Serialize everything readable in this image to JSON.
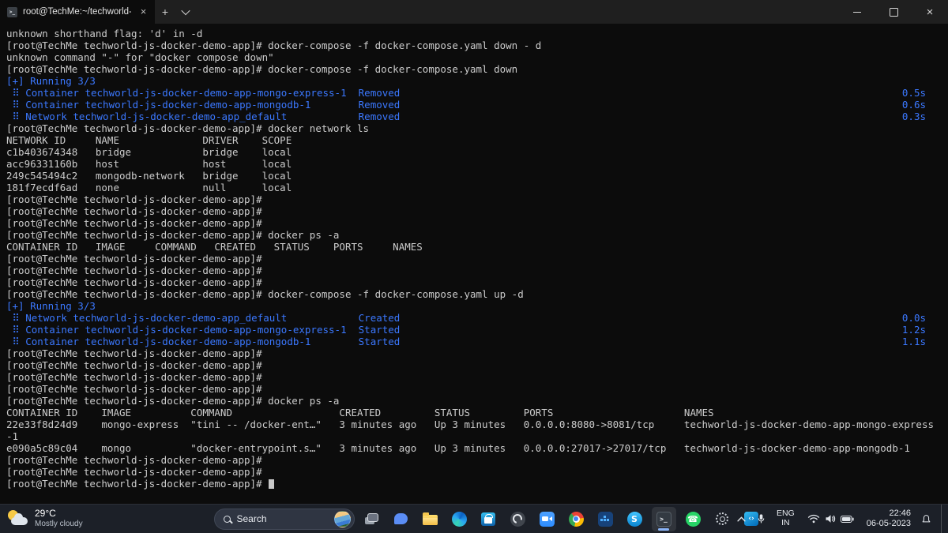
{
  "window": {
    "tab_title": "root@TechMe:~/techworld-js"
  },
  "terminal": {
    "lines": [
      {
        "c": "fg",
        "t": "unknown shorthand flag: 'd' in -d"
      },
      {
        "c": "fg",
        "t": "[root@TechMe techworld-js-docker-demo-app]# docker-compose -f docker-compose.yaml down - d"
      },
      {
        "c": "fg",
        "t": "unknown command \"-\" for \"docker compose down\""
      },
      {
        "c": "fg",
        "t": "[root@TechMe techworld-js-docker-demo-app]# docker-compose -f docker-compose.yaml down"
      },
      {
        "c": "blue",
        "t": "[+] Running 3/3"
      },
      {
        "c": "blue",
        "t": " ⠿ Container techworld-js-docker-demo-app-mongo-express-1  Removed",
        "r": "0.5s"
      },
      {
        "c": "blue",
        "t": " ⠿ Container techworld-js-docker-demo-app-mongodb-1        Removed",
        "r": "0.6s"
      },
      {
        "c": "blue",
        "t": " ⠿ Network techworld-js-docker-demo-app_default            Removed",
        "r": "0.3s"
      },
      {
        "c": "fg",
        "t": "[root@TechMe techworld-js-docker-demo-app]# docker network ls"
      },
      {
        "c": "fg",
        "t": "NETWORK ID     NAME              DRIVER    SCOPE"
      },
      {
        "c": "fg",
        "t": "c1b403674348   bridge            bridge    local"
      },
      {
        "c": "fg",
        "t": "acc96331160b   host              host      local"
      },
      {
        "c": "fg",
        "t": "249c545494c2   mongodb-network   bridge    local"
      },
      {
        "c": "fg",
        "t": "181f7ecdf6ad   none              null      local"
      },
      {
        "c": "fg",
        "t": "[root@TechMe techworld-js-docker-demo-app]#"
      },
      {
        "c": "fg",
        "t": "[root@TechMe techworld-js-docker-demo-app]#"
      },
      {
        "c": "fg",
        "t": "[root@TechMe techworld-js-docker-demo-app]#"
      },
      {
        "c": "fg",
        "t": "[root@TechMe techworld-js-docker-demo-app]# docker ps -a"
      },
      {
        "c": "fg",
        "t": "CONTAINER ID   IMAGE     COMMAND   CREATED   STATUS    PORTS     NAMES"
      },
      {
        "c": "fg",
        "t": "[root@TechMe techworld-js-docker-demo-app]#"
      },
      {
        "c": "fg",
        "t": "[root@TechMe techworld-js-docker-demo-app]#"
      },
      {
        "c": "fg",
        "t": "[root@TechMe techworld-js-docker-demo-app]#"
      },
      {
        "c": "fg",
        "t": "[root@TechMe techworld-js-docker-demo-app]# docker-compose -f docker-compose.yaml up -d"
      },
      {
        "c": "blue",
        "t": "[+] Running 3/3"
      },
      {
        "c": "blue",
        "t": " ⠿ Network techworld-js-docker-demo-app_default            Created",
        "r": "0.0s"
      },
      {
        "c": "blue",
        "t": " ⠿ Container techworld-js-docker-demo-app-mongo-express-1  Started",
        "r": "1.2s"
      },
      {
        "c": "blue",
        "t": " ⠿ Container techworld-js-docker-demo-app-mongodb-1        Started",
        "r": "1.1s"
      },
      {
        "c": "fg",
        "t": "[root@TechMe techworld-js-docker-demo-app]#"
      },
      {
        "c": "fg",
        "t": "[root@TechMe techworld-js-docker-demo-app]#"
      },
      {
        "c": "fg",
        "t": "[root@TechMe techworld-js-docker-demo-app]#"
      },
      {
        "c": "fg",
        "t": "[root@TechMe techworld-js-docker-demo-app]#"
      },
      {
        "c": "fg",
        "t": "[root@TechMe techworld-js-docker-demo-app]# docker ps -a"
      },
      {
        "c": "fg",
        "t": "CONTAINER ID    IMAGE          COMMAND                  CREATED         STATUS         PORTS                      NAMES"
      },
      {
        "c": "fg",
        "t": "22e33f8d24d9    mongo-express  \"tini -- /docker-ent…\"   3 minutes ago   Up 3 minutes   0.0.0.0:8080->8081/tcp     techworld-js-docker-demo-app-mongo-express"
      },
      {
        "c": "fg",
        "t": "-1"
      },
      {
        "c": "fg",
        "t": "e090a5c89c04    mongo          \"docker-entrypoint.s…\"   3 minutes ago   Up 3 minutes   0.0.0.0:27017->27017/tcp   techworld-js-docker-demo-app-mongodb-1"
      },
      {
        "c": "fg",
        "t": "[root@TechMe techworld-js-docker-demo-app]#"
      },
      {
        "c": "fg",
        "t": "[root@TechMe techworld-js-docker-demo-app]#"
      },
      {
        "c": "fg",
        "t": "[root@TechMe techworld-js-docker-demo-app]# ",
        "cursor": true
      }
    ]
  },
  "taskbar": {
    "weather": {
      "temp": "29°C",
      "condition": "Mostly cloudy"
    },
    "search_label": "Search",
    "apps": [
      {
        "key": "taskview",
        "name": "task-view-icon"
      },
      {
        "key": "teams",
        "name": "teams-chat-icon"
      },
      {
        "key": "folder",
        "name": "file-explorer-icon"
      },
      {
        "key": "edge",
        "name": "edge-browser-icon"
      },
      {
        "key": "store",
        "name": "microsoft-store-icon"
      },
      {
        "key": "obs",
        "name": "obs-studio-icon"
      },
      {
        "key": "zoom",
        "name": "zoom-icon"
      },
      {
        "key": "chrome",
        "name": "chrome-icon"
      },
      {
        "key": "docker",
        "name": "docker-desktop-icon"
      },
      {
        "key": "skype",
        "name": "skype-icon",
        "glyph": "S"
      },
      {
        "key": "terminal",
        "name": "windows-terminal-icon",
        "glyph": ">_",
        "active": true
      },
      {
        "key": "whatsapp",
        "name": "whatsapp-icon",
        "glyph": "☎"
      },
      {
        "key": "settings",
        "name": "settings-gear-icon"
      },
      {
        "key": "vscode",
        "name": "vscode-icon",
        "glyph": "‹›"
      }
    ],
    "tray": {
      "language_top": "ENG",
      "language_bottom": "IN",
      "time": "22:46",
      "date": "06-05-2023"
    }
  },
  "colors": {
    "terminal_bg": "#0c0c0c",
    "terminal_fg": "#cccccc",
    "terminal_blue": "#3b78ff"
  }
}
